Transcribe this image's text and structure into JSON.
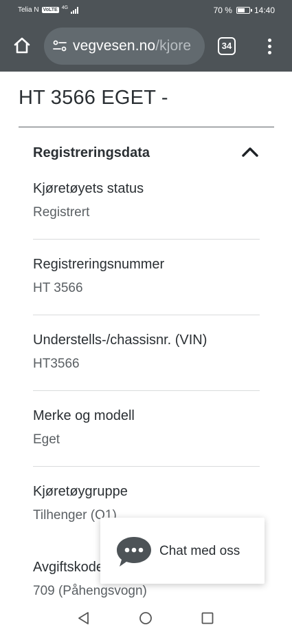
{
  "status_bar": {
    "carrier": "Telia N",
    "volte": "VoLTE",
    "network": "4G",
    "battery_percent": "70 %",
    "battery_level": 0.7,
    "time": "14:40"
  },
  "browser": {
    "url_host": "vegvesen.no",
    "url_path": "/kjore",
    "tab_count": "34",
    "icons": [
      "home-icon",
      "site-settings-icon",
      "tabs-icon",
      "overflow-menu-icon"
    ]
  },
  "page": {
    "title": "HT 3566 EGET -",
    "section": {
      "title": "Registreringsdata",
      "expanded": true,
      "fields": [
        {
          "label": "Kjøretøyets status",
          "value": "Registrert"
        },
        {
          "label": "Registreringsnummer",
          "value": "HT 3566"
        },
        {
          "label": "Understells-/chassisnr. (VIN)",
          "value": "HT3566"
        },
        {
          "label": "Merke og modell",
          "value": "Eget"
        },
        {
          "label": "Kjøretøygruppe",
          "value": "Tilhenger (O1)"
        },
        {
          "label": "Avgiftskode",
          "value": "709 (Påhengsvogn)"
        }
      ]
    }
  },
  "chat_widget": {
    "label": "Chat med oss",
    "icon": "chat-bubble-icon"
  },
  "colors": {
    "browser_chrome": "#4d5357",
    "url_bar": "#626a6f",
    "text": "#2a2f33",
    "value_text": "#5a5f63"
  }
}
